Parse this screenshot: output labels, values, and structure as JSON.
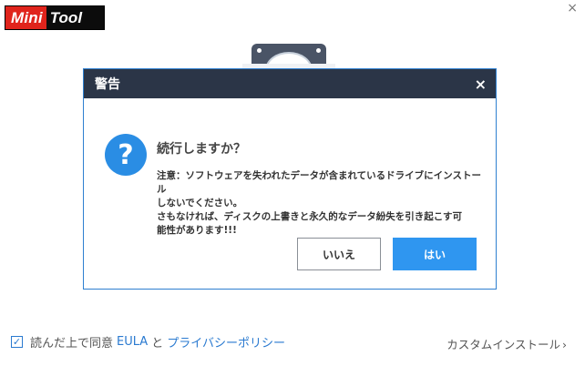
{
  "app": {
    "logo_part1": "Mini",
    "logo_part2": "Tool",
    "close_glyph": "×"
  },
  "dialog": {
    "title": "警告",
    "close_glyph": "×",
    "icon": "question-icon",
    "icon_glyph": "?",
    "heading": "続行しますか？",
    "message_lines": [
      "注意：ソフトウェアを失われたデータが含まれているドライブにインストール",
      "しないでください。",
      "さもなければ、ディスクの上書きと永久的なデータ紛失を引き起こす可",
      "能性があります!!!"
    ],
    "no_label": "いいえ",
    "yes_label": "はい"
  },
  "footer": {
    "checkbox_checked": true,
    "agree_prefix": "読んだ上で同意",
    "eula_link": "EULA",
    "and": "と",
    "privacy_link": "プライバシーポリシー",
    "custom_install": "カスタムインストール",
    "chevron": "›"
  },
  "colors": {
    "titlebar": "#2b3547",
    "accent": "#2f96f0",
    "logo_red": "#e0241c"
  }
}
